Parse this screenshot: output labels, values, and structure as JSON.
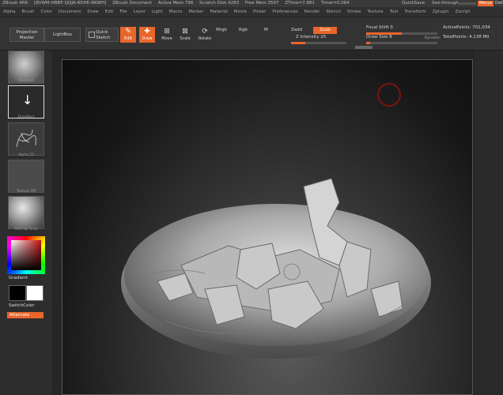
{
  "titlebar": {
    "app": "ZBrush 4R6",
    "serial": "[BVWM-HBBF-QQJA-RDHE-NKWH]",
    "document": "ZBrush Document",
    "active_mem": "Active Mem 798",
    "scratch_disk": "Scratch Disk 4283",
    "free_mem": "Free Mem 3597",
    "ztime": "ZTime=7.881",
    "timer": "Timer=0.084",
    "quicksave": "QuickSave",
    "see_through": "See-through",
    "see_through_value": 0,
    "menus": "Menus",
    "dfl": "Def"
  },
  "menubar": [
    "Alpha",
    "Brush",
    "Color",
    "Document",
    "Draw",
    "Edit",
    "File",
    "Layer",
    "Light",
    "Macro",
    "Marker",
    "Material",
    "Movie",
    "Picker",
    "Preferences",
    "Render",
    "Stencil",
    "Stroke",
    "Texture",
    "Tool",
    "Transform",
    "Zplugin",
    "Zscript"
  ],
  "shelf": {
    "projection_master": "Projection Master",
    "lightbox": "LightBox",
    "quick_sketch": "Quick Sketch",
    "edit": "Edit",
    "draw": "Draw",
    "move": "Move",
    "scale": "Scale",
    "rotate": "Rotate",
    "mrgb": "Mrgb",
    "rgb": "Rgb",
    "m": "M",
    "zadd": "Zadd",
    "zsub": "Zsub",
    "z_intensity": "Z Intensity 25",
    "z_intensity_value": 25,
    "focal_shift": "Focal Shift 0",
    "focal_shift_value": 0.5,
    "draw_size": "Draw Size 8",
    "draw_size_value": 0.05,
    "dynamic": "Dynamic",
    "active_points": "ActivePoints: 701,034",
    "total_points": "TotalPoints: 4.138 Mil"
  },
  "tray": {
    "brush_label": "Standard",
    "stroke_label": "DragRect",
    "alpha_label": "Alpha 22",
    "texture_label": "Texture Off",
    "material_label": "MatCap Gray",
    "gradient": "Gradient",
    "switch_color": "SwitchColor",
    "alternate": "Alternate"
  },
  "colors": {
    "accent": "#e8662a",
    "background": "#2b2b2b"
  }
}
